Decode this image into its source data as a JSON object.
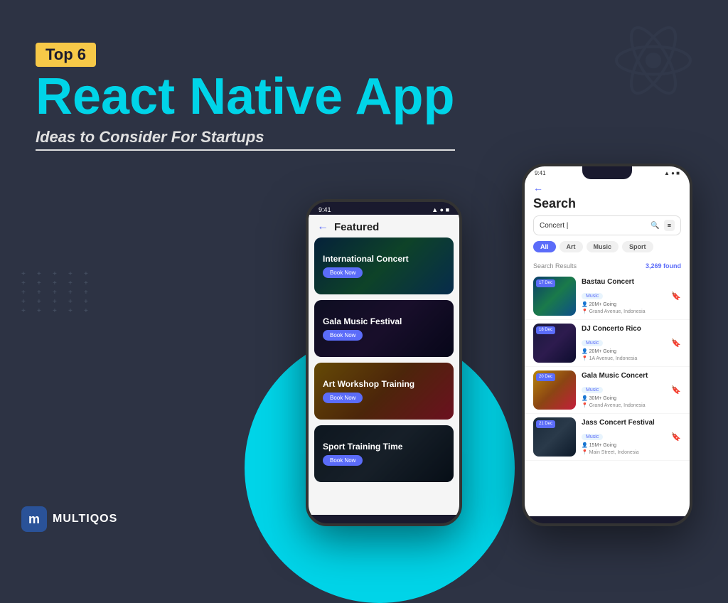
{
  "page": {
    "background_color": "#2d3344",
    "title": "Top 6 React Native App Ideas to Consider For Startups"
  },
  "header": {
    "badge": "Top 6",
    "main_title": "React Native App",
    "subtitle": "Ideas to Consider For Startups"
  },
  "logo": {
    "text": "MULTIQOS"
  },
  "phone1": {
    "status_time": "9:41",
    "title": "Featured",
    "back_label": "←",
    "cards": [
      {
        "title": "International Concert",
        "btn": "Book Now",
        "bg": "bg-concert"
      },
      {
        "title": "Gala Music Festival",
        "btn": "Book Now",
        "bg": "bg-music"
      },
      {
        "title": "Art Workshop Training",
        "btn": "Book Now",
        "bg": "bg-art"
      },
      {
        "title": "Sport Training Time",
        "btn": "Book Now",
        "bg": "bg-sport"
      }
    ]
  },
  "phone2": {
    "status_time": "9:41",
    "title": "Search",
    "back_label": "←",
    "search_value": "Concert |",
    "filter_chips": [
      {
        "label": "All",
        "active": true
      },
      {
        "label": "Art",
        "active": false
      },
      {
        "label": "Music",
        "active": false
      },
      {
        "label": "Sport",
        "active": false
      }
    ],
    "results_label": "Search Results",
    "results_count": "3,269 found",
    "results": [
      {
        "date": "17 Dec",
        "name": "Bastau Concert",
        "tag": "Music",
        "going": "20M+ Going",
        "location": "Grand Avenue, Indonesia"
      },
      {
        "date": "18 Dec",
        "name": "DJ Concerto Rico",
        "tag": "Music",
        "going": "20M+ Going",
        "location": "1A Avenue, Indonesia"
      },
      {
        "date": "20 Dec",
        "name": "Gala Music Concert",
        "tag": "Music",
        "going": "30M+ Going",
        "location": "Grand Avenue, Indonesia"
      },
      {
        "date": "21 Dec",
        "name": "Jass Concert Festival",
        "tag": "Music",
        "going": "15M+ Going",
        "location": "Main Street, Indonesia"
      }
    ]
  },
  "dots": [
    "+",
    "+",
    "+",
    "+",
    "+",
    "+",
    "+",
    "+",
    "+",
    "+",
    "+",
    "+",
    "+",
    "+",
    "+",
    "+",
    "+",
    "+",
    "+",
    "+",
    "+",
    "+",
    "+",
    "+",
    "+"
  ]
}
